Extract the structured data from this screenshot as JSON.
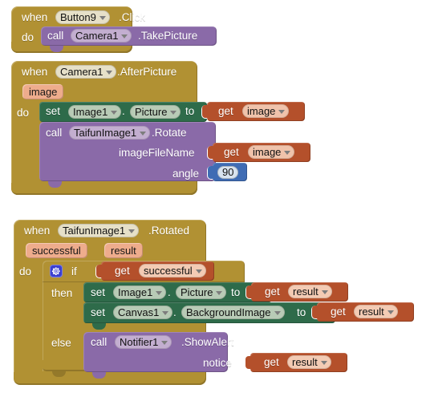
{
  "editor": {
    "name": "MIT App Inventor Blocks Editor",
    "background": "#ffffff"
  },
  "palette": {
    "event_gold": "#b19133",
    "method_purple": "#8a6aa8",
    "setter_green": "#2e6b4a",
    "variable_orange": "#b4502b",
    "number_blue": "#3f6cb4",
    "param_peach": "#eeac8c",
    "gear_blue": "#3b3fd0"
  },
  "blocks": [
    {
      "id": "button9-click",
      "kind": "event",
      "when_label": "when",
      "component": "Button9",
      "event": ".Click",
      "do_label": "do",
      "body": [
        {
          "kind": "method-call",
          "call_label": "call",
          "component": "Camera1",
          "method": ".TakePicture"
        }
      ]
    },
    {
      "id": "camera1-afterpicture",
      "kind": "event",
      "when_label": "when",
      "component": "Camera1",
      "event": ".AfterPicture",
      "params": [
        "image"
      ],
      "do_label": "do",
      "body": [
        {
          "kind": "setter",
          "set_label": "set",
          "component": "Image1",
          "dot": ".",
          "property": "Picture",
          "to_label": "to",
          "value": {
            "kind": "get",
            "get_label": "get",
            "variable": "image"
          }
        },
        {
          "kind": "method-call",
          "call_label": "call",
          "component": "TaifunImage1",
          "method": ".Rotate",
          "args": [
            {
              "name": "imageFileName",
              "value": {
                "kind": "get",
                "get_label": "get",
                "variable": "image"
              }
            },
            {
              "name": "angle",
              "value": {
                "kind": "number",
                "number": "90"
              }
            }
          ]
        }
      ]
    },
    {
      "id": "taifunimage1-rotated",
      "kind": "event",
      "when_label": "when",
      "component": "TaifunImage1",
      "event": ".Rotated",
      "params": [
        "successful",
        "result"
      ],
      "do_label": "do",
      "body": [
        {
          "kind": "if-else",
          "gear_icon": "gear-icon",
          "if_label": "if",
          "then_label": "then",
          "else_label": "else",
          "condition": {
            "kind": "get",
            "get_label": "get",
            "variable": "successful"
          },
          "then_body": [
            {
              "kind": "setter",
              "set_label": "set",
              "component": "Image1",
              "dot": ".",
              "property": "Picture",
              "to_label": "to",
              "value": {
                "kind": "get",
                "get_label": "get",
                "variable": "result"
              }
            },
            {
              "kind": "setter",
              "set_label": "set",
              "component": "Canvas1",
              "dot": ".",
              "property": "BackgroundImage",
              "to_label": "to",
              "value": {
                "kind": "get",
                "get_label": "get",
                "variable": "result"
              }
            }
          ],
          "else_body": [
            {
              "kind": "method-call",
              "call_label": "call",
              "component": "Notifier1",
              "method": ".ShowAlert",
              "args": [
                {
                  "name": "notice",
                  "value": {
                    "kind": "get",
                    "get_label": "get",
                    "variable": "result"
                  }
                }
              ]
            }
          ]
        }
      ]
    }
  ]
}
